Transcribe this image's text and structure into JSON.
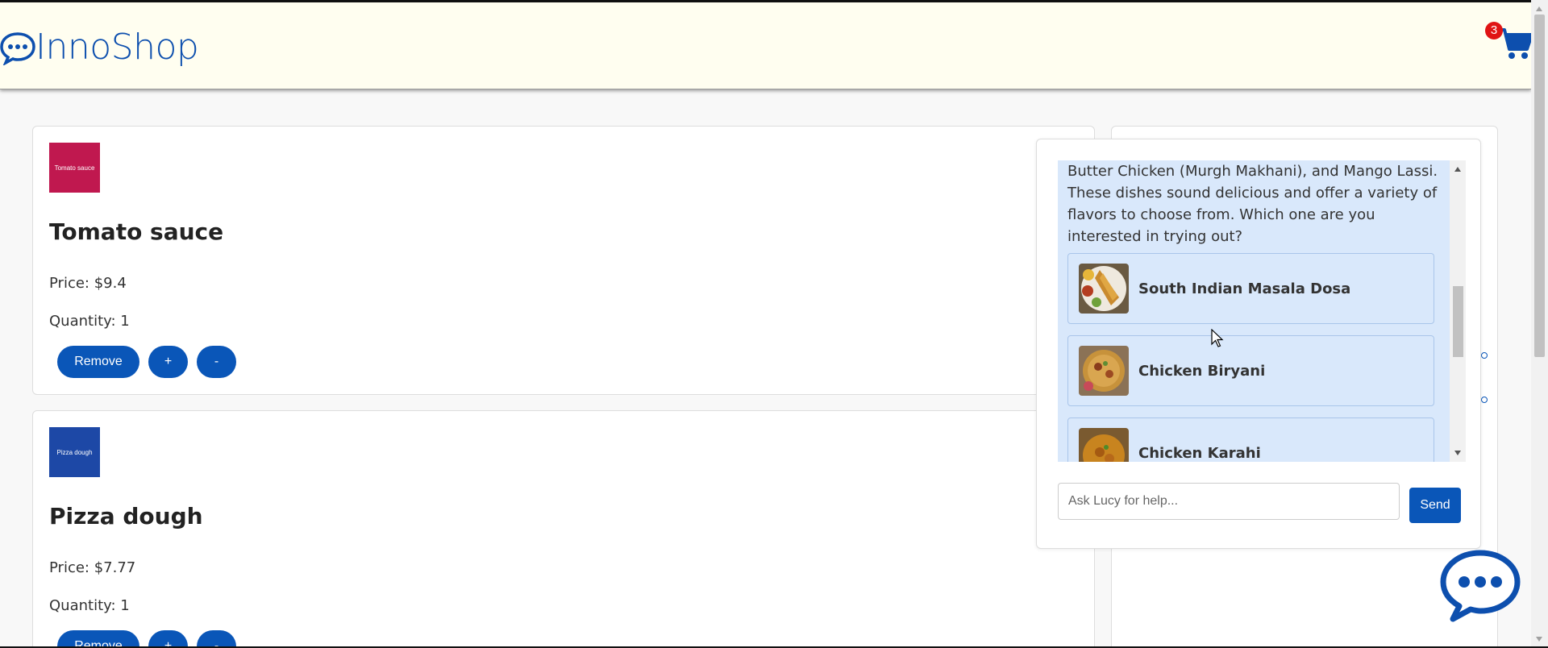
{
  "header": {
    "brand": "InnoShop",
    "cart_count": "3"
  },
  "cart_items": [
    {
      "thumb_label": "Tomato sauce",
      "thumb_color": "#c0184f",
      "name": "Tomato sauce",
      "price": "Price: $9.4",
      "quantity": "Quantity: 1",
      "remove_label": "Remove",
      "plus_label": "+",
      "minus_label": "-"
    },
    {
      "thumb_label": "Pizza dough",
      "thumb_color": "#1d48a6",
      "name": "Pizza dough",
      "price": "Price: $7.77",
      "quantity": "Quantity: 1",
      "remove_label": "Remove",
      "plus_label": "+",
      "minus_label": "-"
    }
  ],
  "chat": {
    "message": "Butter Chicken (Murgh Makhani), and Mango Lassi. These dishes sound delicious and offer a variety of flavors to choose from. Which one are you interested in trying out?",
    "suggestions": [
      {
        "name": "South Indian Masala Dosa",
        "image_icon": "masala-dosa-food-image"
      },
      {
        "name": "Chicken Biryani",
        "image_icon": "chicken-biryani-food-image"
      },
      {
        "name": "Chicken Karahi",
        "image_icon": "chicken-karahi-food-image"
      }
    ],
    "input_placeholder": "Ask Lucy for help...",
    "send_label": "Send"
  },
  "colors": {
    "brand": "#0d4fae",
    "button": "#0a56b8",
    "chat_bg": "#d9e8fb",
    "header_bg": "#fffef0",
    "badge": "#e01414"
  }
}
